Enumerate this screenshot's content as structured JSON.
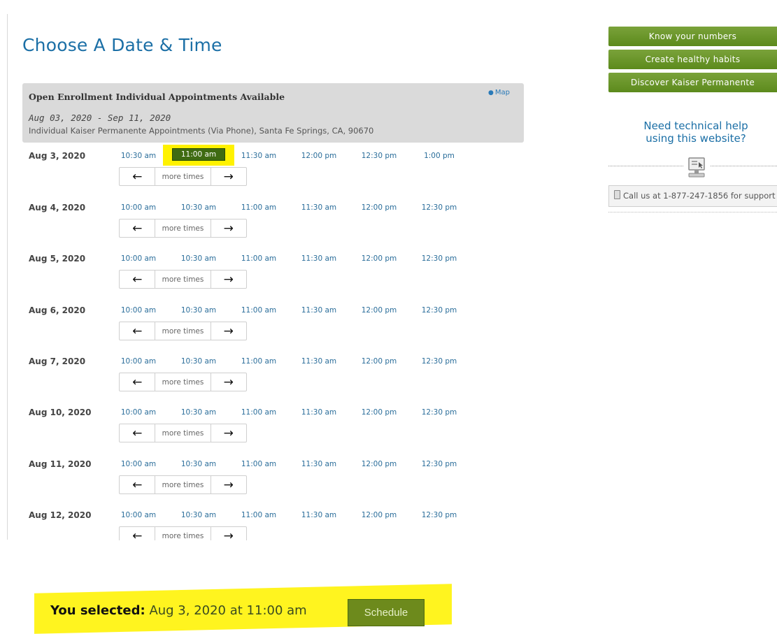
{
  "page": {
    "title": "Choose A Date & Time"
  },
  "info": {
    "title": "Open Enrollment Individual Appointments Available",
    "map_label": "Map",
    "date_range": "Aug 03, 2020 - Sep 11, 2020",
    "location": "Individual Kaiser Permanente Appointments (Via Phone), Santa Fe Springs, CA, 90670"
  },
  "days": [
    {
      "date": "Aug 3, 2020",
      "slots": [
        "10:30 am",
        "11:00 am",
        "11:30 am",
        "12:00 pm",
        "12:30 pm",
        "1:00 pm"
      ],
      "selected_index": 1
    },
    {
      "date": "Aug 4, 2020",
      "slots": [
        "10:00 am",
        "10:30 am",
        "11:00 am",
        "11:30 am",
        "12:00 pm",
        "12:30 pm"
      ]
    },
    {
      "date": "Aug 5, 2020",
      "slots": [
        "10:00 am",
        "10:30 am",
        "11:00 am",
        "11:30 am",
        "12:00 pm",
        "12:30 pm"
      ]
    },
    {
      "date": "Aug 6, 2020",
      "slots": [
        "10:00 am",
        "10:30 am",
        "11:00 am",
        "11:30 am",
        "12:00 pm",
        "12:30 pm"
      ]
    },
    {
      "date": "Aug 7, 2020",
      "slots": [
        "10:00 am",
        "10:30 am",
        "11:00 am",
        "11:30 am",
        "12:00 pm",
        "12:30 pm"
      ]
    },
    {
      "date": "Aug 10, 2020",
      "slots": [
        "10:00 am",
        "10:30 am",
        "11:00 am",
        "11:30 am",
        "12:00 pm",
        "12:30 pm"
      ]
    },
    {
      "date": "Aug 11, 2020",
      "slots": [
        "10:00 am",
        "10:30 am",
        "11:00 am",
        "11:30 am",
        "12:00 pm",
        "12:30 pm"
      ]
    },
    {
      "date": "Aug 12, 2020",
      "slots": [
        "10:00 am",
        "10:30 am",
        "11:00 am",
        "11:30 am",
        "12:00 pm",
        "12:30 pm"
      ]
    }
  ],
  "pager": {
    "prev_icon": "←",
    "more_label": "more times",
    "next_icon": "→"
  },
  "sidebar": {
    "buttons": [
      "Know your numbers",
      "Create healthy habits",
      "Discover Kaiser Permanente"
    ],
    "help_title_line1": "Need technical help",
    "help_title_line2": "using this website?",
    "call_text": "Call us at 1-877-247-1856 for support"
  },
  "selection": {
    "label": "You selected:",
    "value": "Aug 3, 2020 at 11:00 am",
    "schedule_label": "Schedule"
  },
  "colors": {
    "accent_blue": "#1b6fa6",
    "button_green": "#6d8a1c",
    "highlight_yellow": "#fff41f"
  }
}
